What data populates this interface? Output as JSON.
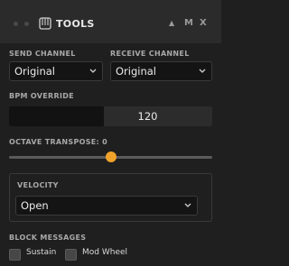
{
  "header": {
    "title": "TOOLS",
    "controls": [
      "▲",
      "M",
      "X"
    ]
  },
  "send_channel": {
    "label": "SEND CHANNEL",
    "value": "Original"
  },
  "receive_channel": {
    "label": "RECEIVE CHANNEL",
    "value": "Original"
  },
  "bpm_override": {
    "label": "BPM OVERRIDE",
    "value": "120"
  },
  "octave_transpose": {
    "label": "OCTAVE TRANSPOSE: 0",
    "value": 0,
    "min": -4,
    "max": 4
  },
  "velocity": {
    "label": "VELOCITY",
    "value": "Open"
  },
  "block_messages": {
    "label": "BLOCK MESSAGES",
    "options": [
      {
        "label": "Sustain",
        "checked": false
      },
      {
        "label": "Mod Wheel",
        "checked": false
      }
    ]
  },
  "colors": {
    "accent": "#f0a32a",
    "background": "#1f1f1f",
    "titlebar": "#2b2b2b"
  }
}
